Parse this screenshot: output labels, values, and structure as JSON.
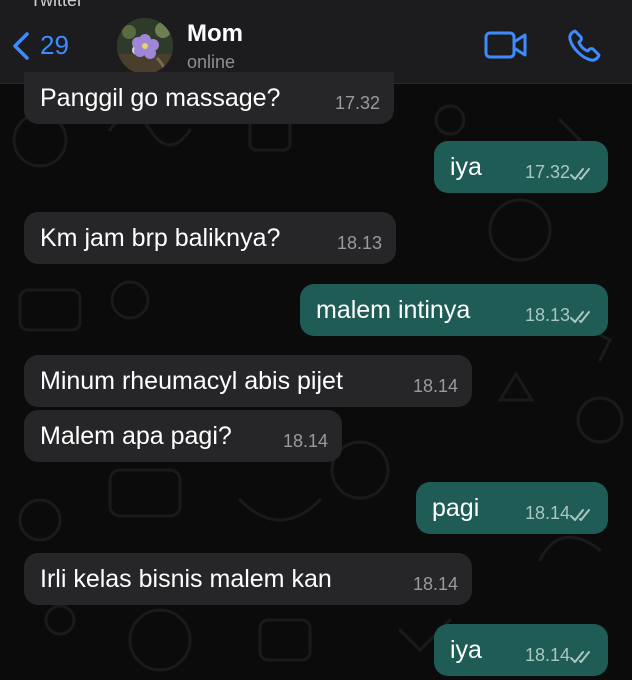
{
  "header": {
    "top_partial_text": "Twitter",
    "back_count": "29",
    "contact_name": "Mom",
    "contact_status": "online"
  },
  "messages": [
    {
      "text": "Panggil go massage?",
      "time": "17.32",
      "direction": "incoming"
    },
    {
      "text": "iya",
      "time": "17.32",
      "direction": "outgoing",
      "read": true
    },
    {
      "text": "Km jam brp baliknya?",
      "time": "18.13",
      "direction": "incoming"
    },
    {
      "text": "malem intinya",
      "time": "18.13",
      "direction": "outgoing",
      "read": true
    },
    {
      "text": "Minum rheumacyl abis pijet",
      "time": "18.14",
      "direction": "incoming"
    },
    {
      "text": "Malem apa pagi?",
      "time": "18.14",
      "direction": "incoming"
    },
    {
      "text": "pagi",
      "time": "18.14",
      "direction": "outgoing",
      "read": true
    },
    {
      "text": "Irli kelas bisnis malem kan",
      "time": "18.14",
      "direction": "incoming"
    },
    {
      "text": "iya",
      "time": "18.14",
      "direction": "outgoing",
      "read": true
    }
  ],
  "colors": {
    "accent": "#3d8bff",
    "incoming_bubble": "#262628",
    "outgoing_bubble": "#1f5c56",
    "background": "#0b0b0b"
  },
  "icons": {
    "back": "chevron-left-icon",
    "video": "video-camera-icon",
    "call": "phone-icon",
    "read": "double-check-icon"
  }
}
